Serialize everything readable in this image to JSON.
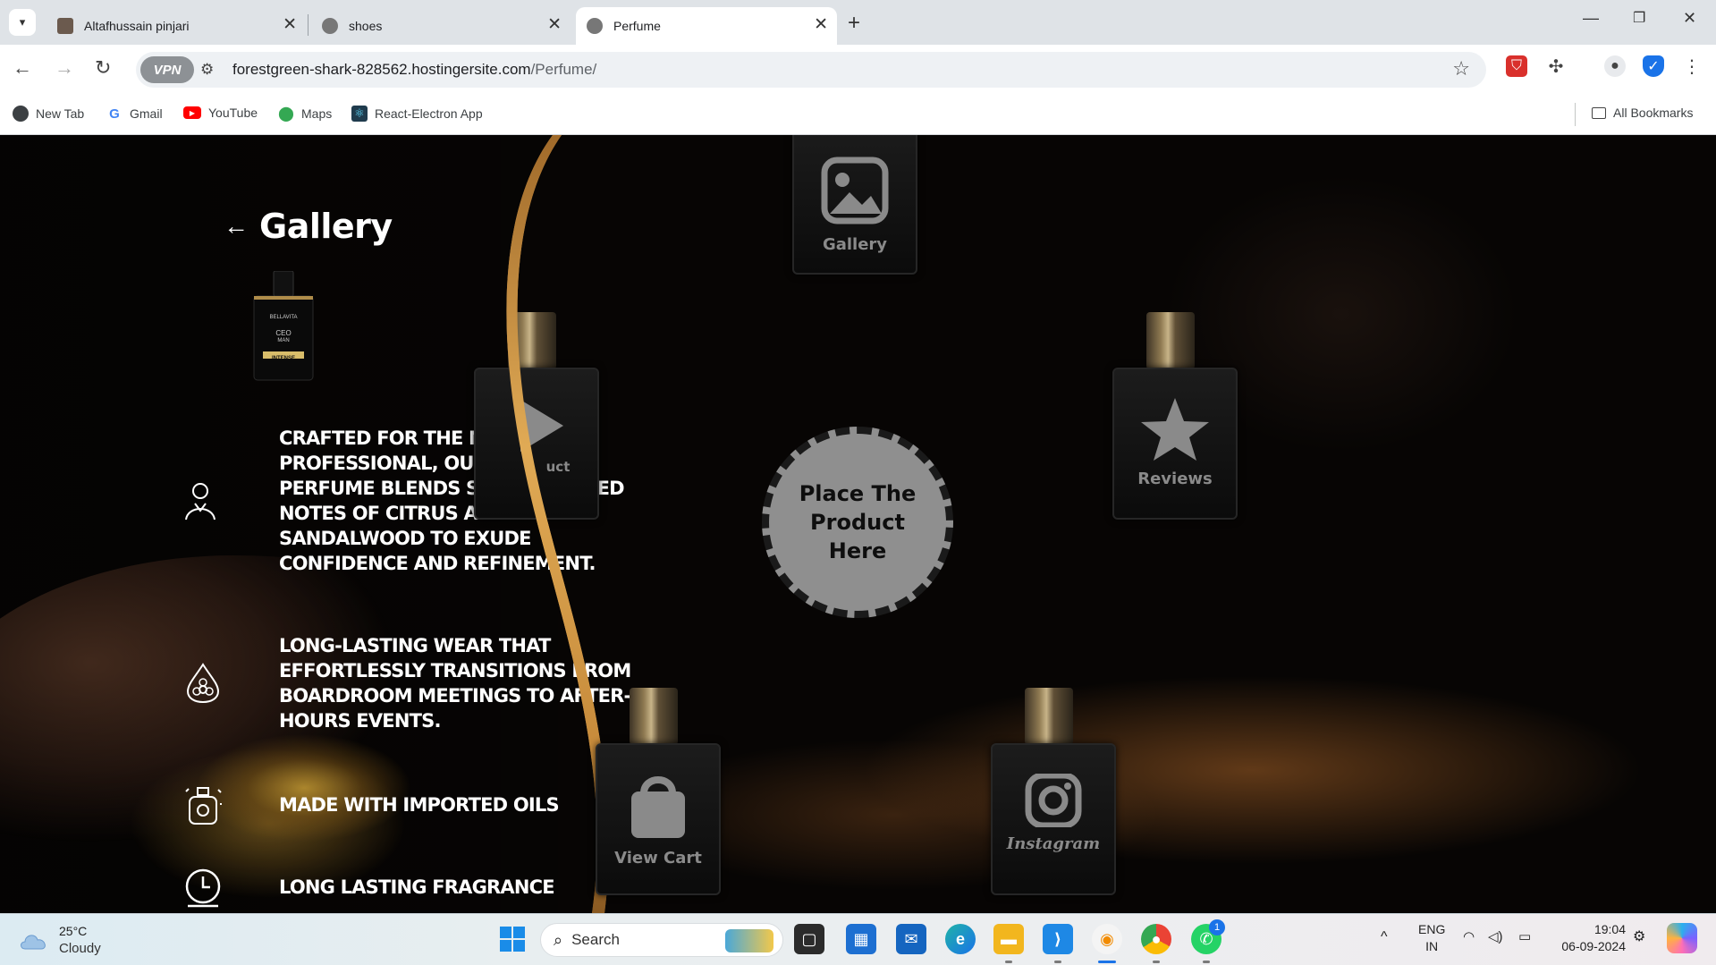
{
  "browser": {
    "tabs": [
      {
        "title": "Altafhussain pinjari",
        "active": false
      },
      {
        "title": "shoes",
        "active": false
      },
      {
        "title": "Perfume",
        "active": true
      }
    ],
    "vpn_label": "VPN",
    "url_host": "forestgreen-shark-828562.hostingersite.com",
    "url_path": "/Perfume/",
    "bookmarks": [
      "New Tab",
      "Gmail",
      "YouTube",
      "Maps",
      "React-Electron App"
    ],
    "all_bookmarks": "All Bookmarks"
  },
  "page": {
    "heading": "Gallery",
    "product_thumb": {
      "brand": "BELLAVITA",
      "name": "CEO",
      "sub": "MAN",
      "badge": "INTENSE"
    },
    "features": [
      {
        "icon": "man-icon",
        "text": "Crafted for the modern professional, our CEO Man perfume blends sophisticated notes of citrus and sandalwood to exude confidence and refinement."
      },
      {
        "icon": "flower-drop-icon",
        "text": "Long-lasting wear that effortlessly transitions from boardroom meetings to after-hours events."
      },
      {
        "icon": "oil-bottle-icon",
        "text": "Made with imported oils"
      },
      {
        "icon": "clock-icon",
        "text": "Long lasting fragrance"
      }
    ],
    "bottles": [
      {
        "label": "Gallery",
        "icon": "image-icon"
      },
      {
        "label": "Product",
        "visible_label": "uct",
        "icon": "play-icon"
      },
      {
        "label": "Reviews",
        "icon": "star-icon"
      },
      {
        "label": "View Cart",
        "icon": "bag-icon"
      },
      {
        "label": "Instagram",
        "icon": "instagram-icon"
      }
    ],
    "drop_zone": {
      "line1": "Place The",
      "line2": "Product",
      "line3": "Here"
    }
  },
  "taskbar": {
    "weather_temp": "25°C",
    "weather_cond": "Cloudy",
    "search_label": "Search",
    "lang_top": "ENG",
    "lang_bottom": "IN",
    "time": "19:04",
    "date": "06-09-2024",
    "whatsapp_badge": "1"
  },
  "colors": {
    "accent_gold": "#d9a24a",
    "page_bg": "#070504",
    "drop_zone": "#8f8f8f"
  }
}
